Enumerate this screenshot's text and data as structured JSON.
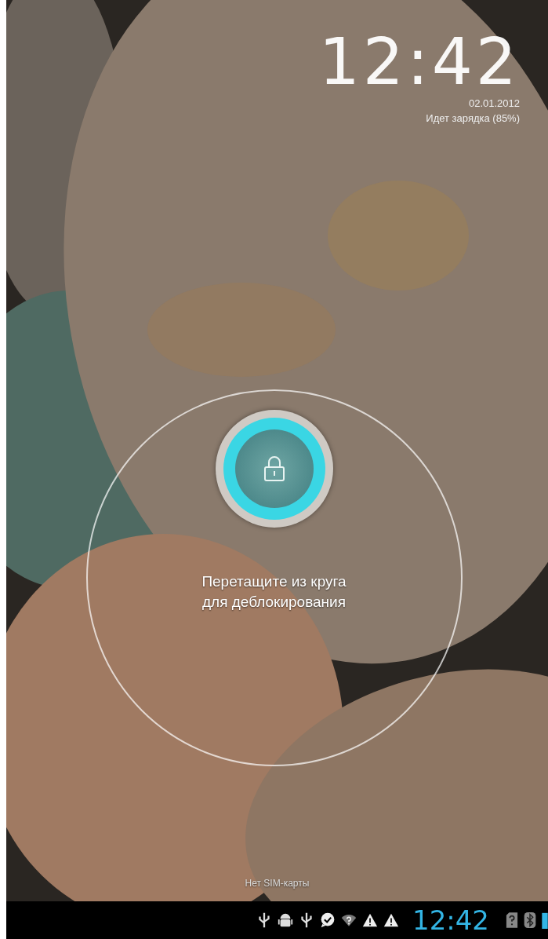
{
  "lock_screen": {
    "clock": "12:42",
    "date": "02.01.2012",
    "charging_status": "Идет зарядка (85%)",
    "unlock_hint": "Перетащите из круга\nдля деблокирования",
    "sim_status": "Нет SIM-карты"
  },
  "status_bar": {
    "time": "12:42"
  }
}
